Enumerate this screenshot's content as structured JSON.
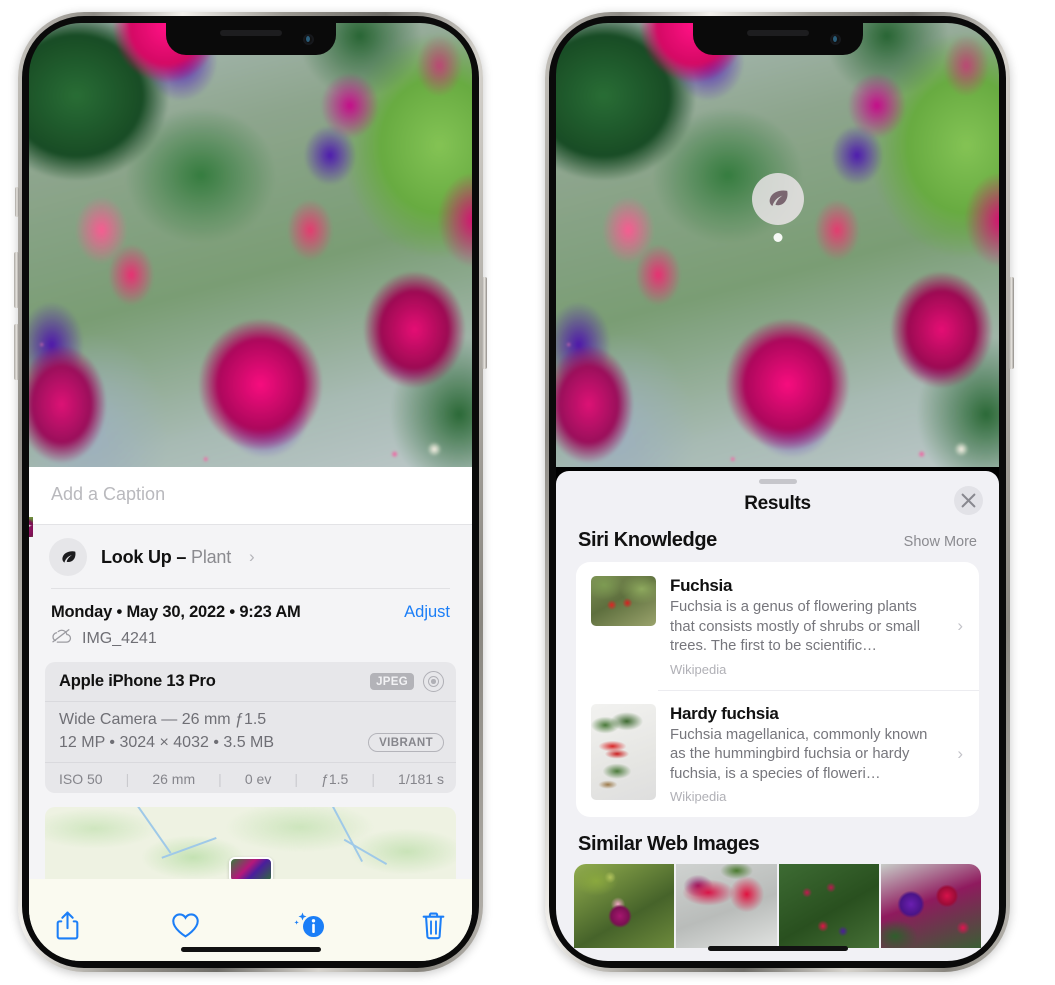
{
  "left_phone": {
    "photo": {
      "alt": "fuchsia-flowers-photo"
    },
    "caption_placeholder": "Add a Caption",
    "lookup": {
      "icon": "leaf-icon",
      "label": "Look Up – ",
      "subject": "Plant",
      "chevron": "›"
    },
    "meta": {
      "date": "Monday • May 30, 2022 • 9:23 AM",
      "adjust": "Adjust",
      "cloud_icon": "cloud-slash-icon",
      "filename": "IMG_4241"
    },
    "camera_card": {
      "device": "Apple iPhone 13 Pro",
      "format_badge": "JPEG",
      "aperture_icon": "aperture-icon",
      "lens_line": "Wide Camera — 26 mm ƒ1.5",
      "specs_line": "12 MP • 3024 × 4032 • 3.5 MB",
      "style_badge": "VIBRANT",
      "exif": [
        "ISO 50",
        "26 mm",
        "0 ev",
        "ƒ1.5",
        "1/181 s"
      ]
    },
    "map": {
      "pin": "photo-location-pin"
    },
    "toolbar": [
      {
        "name": "share-icon",
        "label": "Share"
      },
      {
        "name": "heart-icon",
        "label": "Favorite"
      },
      {
        "name": "info-sparkle-icon",
        "label": "Info"
      },
      {
        "name": "trash-icon",
        "label": "Delete"
      }
    ]
  },
  "right_phone": {
    "photo_badge": {
      "icon": "leaf-icon",
      "name": "visual-look-up-badge"
    },
    "sheet": {
      "grabber": "sheet-grabber",
      "title": "Results",
      "close_icon": "close-icon"
    },
    "siri_knowledge": {
      "heading": "Siri Knowledge",
      "show_more": "Show More",
      "items": [
        {
          "title": "Fuchsia",
          "description": "Fuchsia is a genus of flowering plants that consists mostly of shrubs or small trees. The first to be scientific…",
          "source": "Wikipedia",
          "chevron": "›"
        },
        {
          "title": "Hardy fuchsia",
          "description": "Fuchsia magellanica, commonly known as the hummingbird fuchsia or hardy fuchsia, is a species of floweri…",
          "source": "Wikipedia",
          "chevron": "›"
        }
      ]
    },
    "similar_web_images": {
      "heading": "Similar Web Images",
      "thumbnails": [
        "web-image-1",
        "web-image-2",
        "web-image-3",
        "web-image-4"
      ]
    }
  },
  "colors": {
    "accent_blue": "#1b7ef7",
    "sheet_bg": "#f1f1f5",
    "card_bg": "#ffffff",
    "secondary_text": "#8b8b90"
  }
}
